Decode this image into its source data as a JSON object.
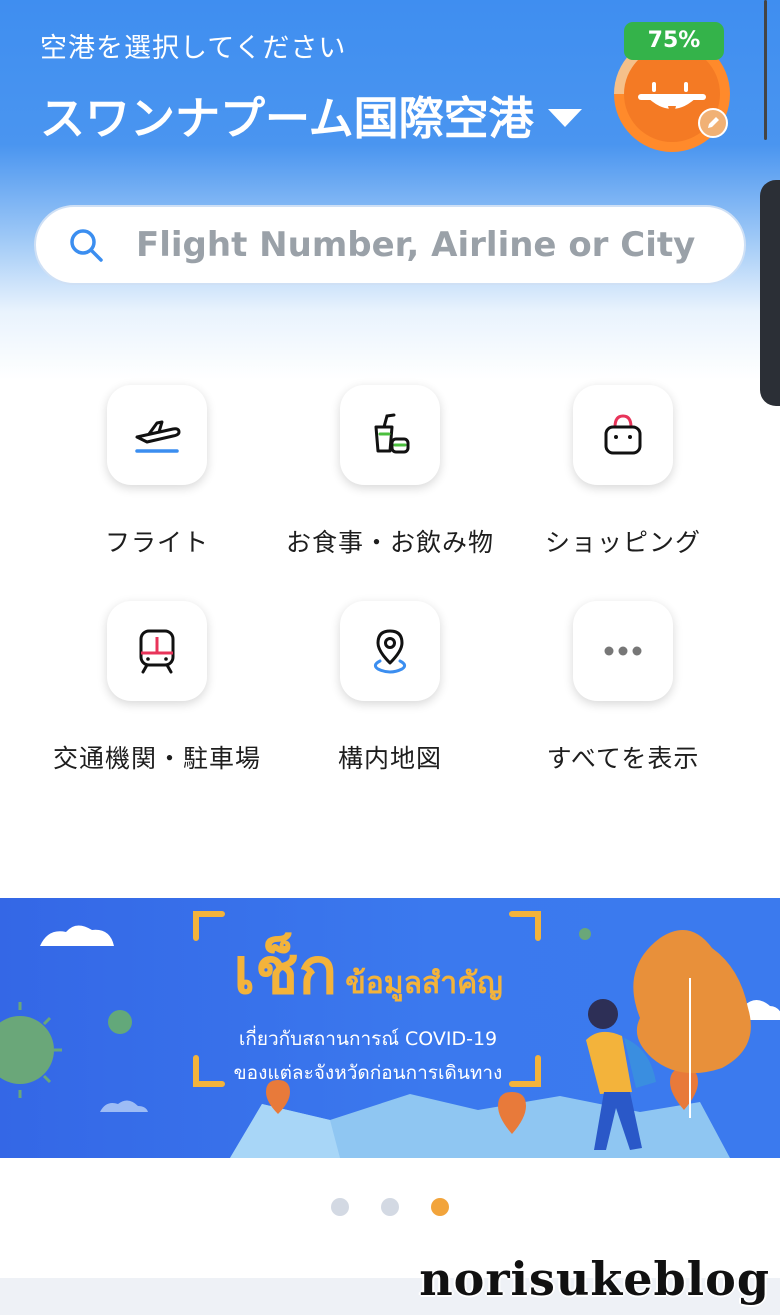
{
  "header": {
    "subtitle": "空港を選択してください",
    "airport_name": "スワンナプーム国際空港",
    "progress_label": "75%",
    "progress_value": 0.75
  },
  "search": {
    "placeholder": "Flight Number, Airline or City"
  },
  "categories": [
    {
      "label": "フライト",
      "icon": "airplane-icon"
    },
    {
      "label": "お食事・お飲み物",
      "icon": "food-drink-icon"
    },
    {
      "label": "ショッピング",
      "icon": "shopping-bag-icon"
    },
    {
      "label": "交通機関・駐車場",
      "icon": "train-icon"
    },
    {
      "label": "構内地図",
      "icon": "map-pin-icon"
    },
    {
      "label": "すべてを表示",
      "icon": "more-icon"
    }
  ],
  "banner": {
    "headline": "เช็ก",
    "headline_suffix": "ข้อมูลสำคัญ",
    "line1": "เกี่ยวกับสถานการณ์ COVID-19",
    "line2": "ของแต่ละจังหวัดก่อนการเดินทาง"
  },
  "carousel": {
    "count": 3,
    "active_index": 2
  },
  "watermark": "norisukeblog",
  "colors": {
    "primary": "#3f8ef0",
    "accent_orange": "#f2a43b",
    "badge_green": "#34b34a"
  }
}
